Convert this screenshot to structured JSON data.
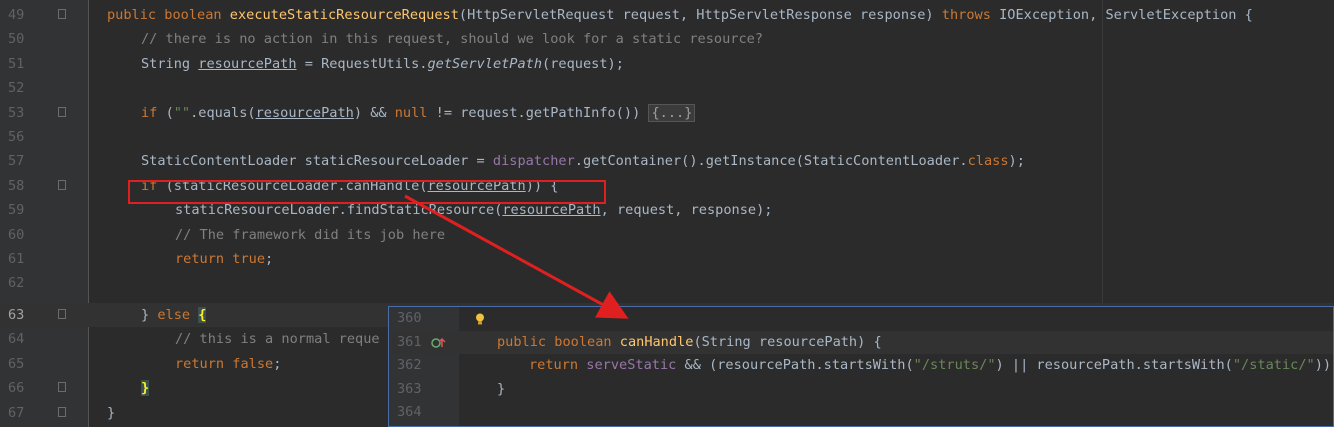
{
  "lines": [
    {
      "n": "49",
      "code": "public boolean executeStaticResourceRequest(HttpServletRequest request, HttpServletResponse response) throws IOException, ServletException {"
    },
    {
      "n": "50",
      "code": "// there is no action in this request, should we look for a static resource?"
    },
    {
      "n": "51",
      "code": "String resourcePath = RequestUtils.getServletPath(request);"
    },
    {
      "n": "52",
      "code": ""
    },
    {
      "n": "53",
      "code": "if (\"\".equals(resourcePath) && null != request.getPathInfo()) {...}"
    },
    {
      "n": "56",
      "code": ""
    },
    {
      "n": "57",
      "code": "StaticContentLoader staticResourceLoader = dispatcher.getContainer().getInstance(StaticContentLoader.class);"
    },
    {
      "n": "58",
      "code": "if (staticResourceLoader.canHandle(resourcePath)) {"
    },
    {
      "n": "59",
      "code": "staticResourceLoader.findStaticResource(resourcePath, request, response);"
    },
    {
      "n": "60",
      "code": "// The framework did its job here"
    },
    {
      "n": "61",
      "code": "return true;"
    },
    {
      "n": "62",
      "code": ""
    },
    {
      "n": "63",
      "code": "} else {"
    },
    {
      "n": "64",
      "code": "// this is a normal reque"
    },
    {
      "n": "65",
      "code": "return false;"
    },
    {
      "n": "66",
      "code": "}"
    },
    {
      "n": "67",
      "code": "}"
    }
  ],
  "popup": {
    "lines": [
      {
        "n": "360",
        "code": ""
      },
      {
        "n": "361",
        "code": "public boolean canHandle(String resourcePath) {"
      },
      {
        "n": "362",
        "code": "return serveStatic && (resourcePath.startsWith(\"/struts/\") || resourcePath.startsWith(\"/static/\"));"
      },
      {
        "n": "363",
        "code": "}"
      },
      {
        "n": "364",
        "code": ""
      }
    ]
  },
  "icons": [
    "fold-marker-icon",
    "lightbulb-icon",
    "override-method-icon",
    "red-arrow-annotation"
  ],
  "colors": {
    "background": "#2b2b2b",
    "keyword": "#cc7832",
    "method": "#ffc66d",
    "comment": "#808080",
    "field": "#9876aa",
    "string": "#6a8759",
    "annotation": "#e02020"
  }
}
